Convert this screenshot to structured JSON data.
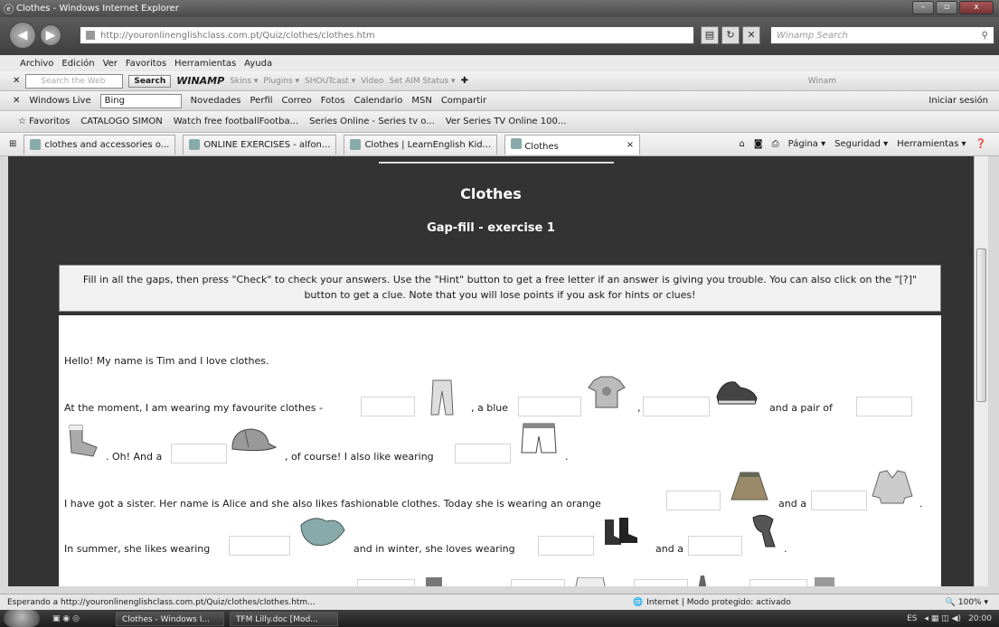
{
  "window": {
    "title": "Clothes - Windows Internet Explorer",
    "controls": [
      "–",
      "▫",
      "x"
    ]
  },
  "address": {
    "url": "http://youronlinenglishclass.com.pt/Quiz/clothes/clothes.htm",
    "search_placeholder": "Winamp Search"
  },
  "menu": [
    "Archivo",
    "Edición",
    "Ver",
    "Favoritos",
    "Herramientas",
    "Ayuda"
  ],
  "toolbar1": {
    "search_placeholder": "Search the Web",
    "search_btn": "Search",
    "winamp": "WINAMP",
    "items": [
      "Skins ▾",
      "Plugins ▾",
      "SHOUTcast ▾",
      "Video",
      "Set AIM Status ▾"
    ],
    "right": "Winam"
  },
  "toolbar2": {
    "live": "Windows Live",
    "bing": "Bing",
    "items": [
      "Novedades",
      "Perfil",
      "Correo",
      "Fotos",
      "Calendario",
      "MSN",
      "Compartir"
    ],
    "signin": "Iniciar sesión"
  },
  "favorites": {
    "label": "Favoritos",
    "items": [
      "CATALOGO SIMON",
      "Watch free footballFootba...",
      "Series Online - Series tv o...",
      "Ver Series TV Online 100..."
    ]
  },
  "tabs": {
    "items": [
      "clothes and accessories o...",
      "ONLINE EXERCISES - alfon...",
      "Clothes | LearnEnglish Kid...",
      "Clothes"
    ],
    "commands": [
      "Página ▾",
      "Seguridad ▾",
      "Herramientas ▾"
    ]
  },
  "page": {
    "title": "Clothes",
    "subtitle": "Gap-fill - exercise 1",
    "instructions": "Fill in all the gaps, then press \"Check\" to check your answers. Use the \"Hint\" button to get a free letter if an answer is giving you trouble. You can also click on the \"[?]\" button to get a clue. Note that you will lose points if you ask for hints or clues!",
    "lines": {
      "l1": "Hello! My name is Tim and I love clothes.",
      "l2a": "At the moment, I am wearing my favourite clothes -",
      "l2b": ", a blue",
      "l2c": ",",
      "l2d": "and a pair of",
      "l3a": ". Oh! And a",
      "l3b": ", of course! I also like wearing",
      "l3c": ".",
      "l4a": "I have got a sister. Her name is Alice and she also likes fashionable clothes. Today she is wearing an orange",
      "l4b": "and a",
      "l4c": ".",
      "l5a": "In summer, she likes wearing",
      "l5b": "and in winter, she loves wearing",
      "l5c": "and a"
    }
  },
  "status": {
    "text": "Esperando a http://youronlinenglishclass.com.pt/Quiz/clothes/clothes.htm...",
    "zone": "Internet | Modo protegido: activado",
    "zoom": "100%"
  },
  "taskbar": {
    "items": [
      "Clothes - Windows I...",
      "TFM Lilly.doc [Mod..."
    ],
    "lang": "ES",
    "time": "20:00"
  }
}
